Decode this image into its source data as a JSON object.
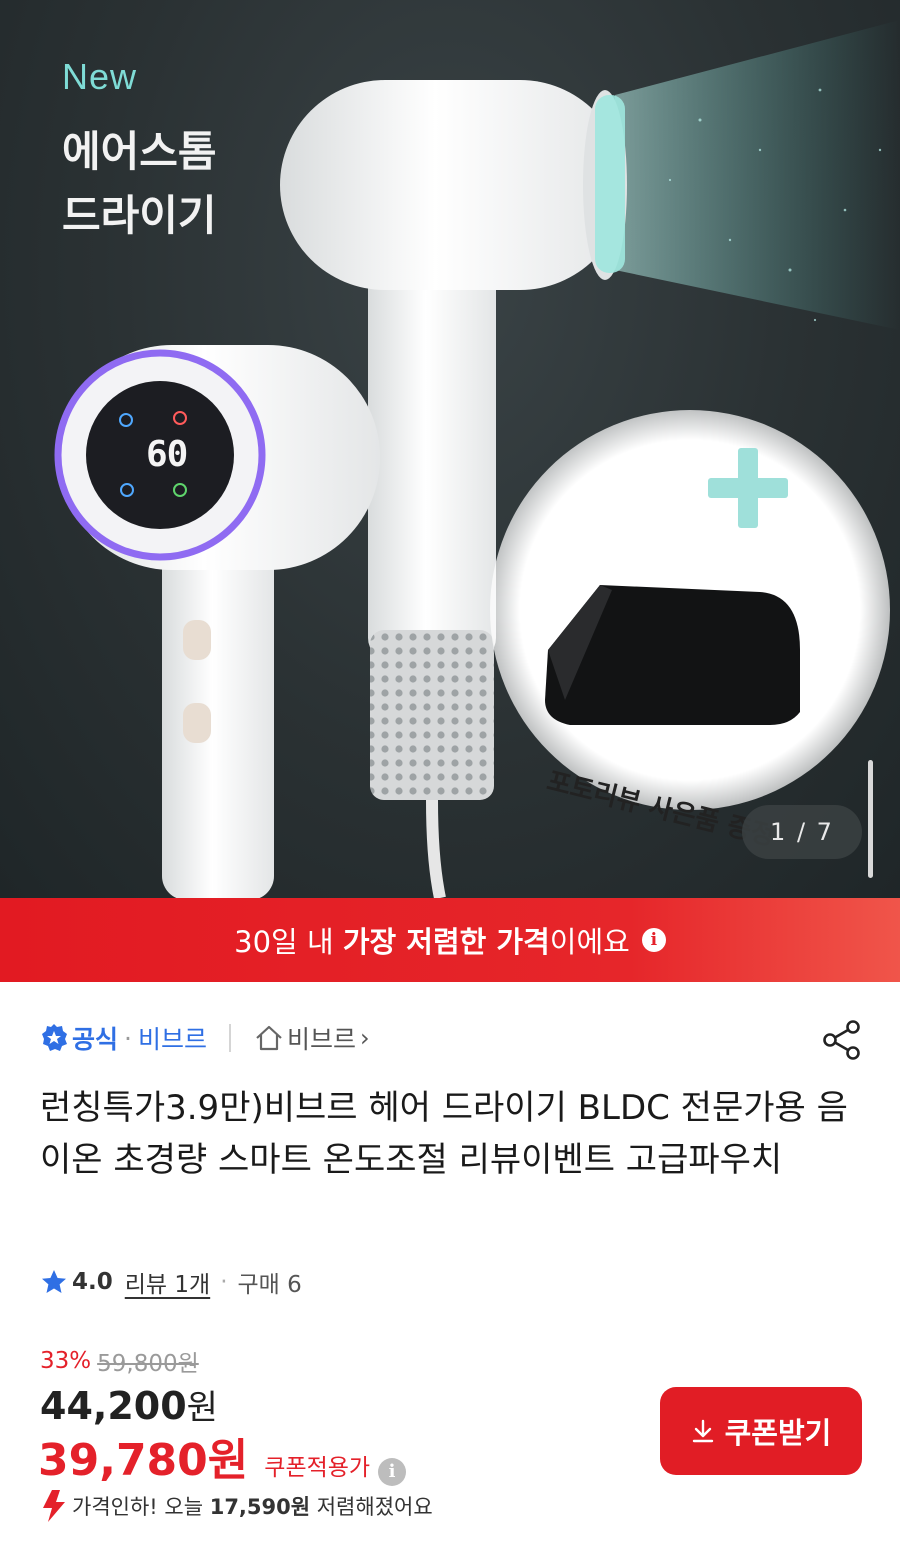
{
  "hero": {
    "new_label": "New",
    "title_line1": "에어스톰",
    "title_line2": "드라이기",
    "display_temp": "60",
    "gift_caption": "포토리뷰 사은품 증정",
    "counter": "1 / 7"
  },
  "banner": {
    "prefix": "30일 내 ",
    "bold": "가장 저렴한 가격",
    "suffix": "이에요",
    "info_icon": "info-icon",
    "color": "#e4212a"
  },
  "seller": {
    "official_label": "공식",
    "separator": "·",
    "brand": "비브르",
    "store_link": "비브르",
    "chevron": "›"
  },
  "product": {
    "title": "런칭특가3.9만)비브르 헤어 드라이기 BLDC 전문가용 음이온 초경량 스마트 온도조절 리뷰이벤트 고급파우치"
  },
  "rating": {
    "value": "4.0",
    "reviews": "리뷰 1개",
    "separator": "·",
    "purchases": "구매 6"
  },
  "price": {
    "discount_pct": "33%",
    "original": "59,800원",
    "sale_value": "44,200",
    "sale_unit": "원",
    "coupon_value": "39,780",
    "coupon_unit": "원",
    "coupon_label": "쿠폰적용가",
    "drop_prefix": "가격인하! 오늘 ",
    "drop_amount": "17,590원",
    "drop_suffix": " 저렴해졌어요"
  },
  "coupon_button": {
    "label": "쿠폰받기"
  },
  "colors": {
    "accent_red": "#e4212a",
    "brand_blue": "#2f6fe4",
    "mint": "#7fdcd6"
  }
}
